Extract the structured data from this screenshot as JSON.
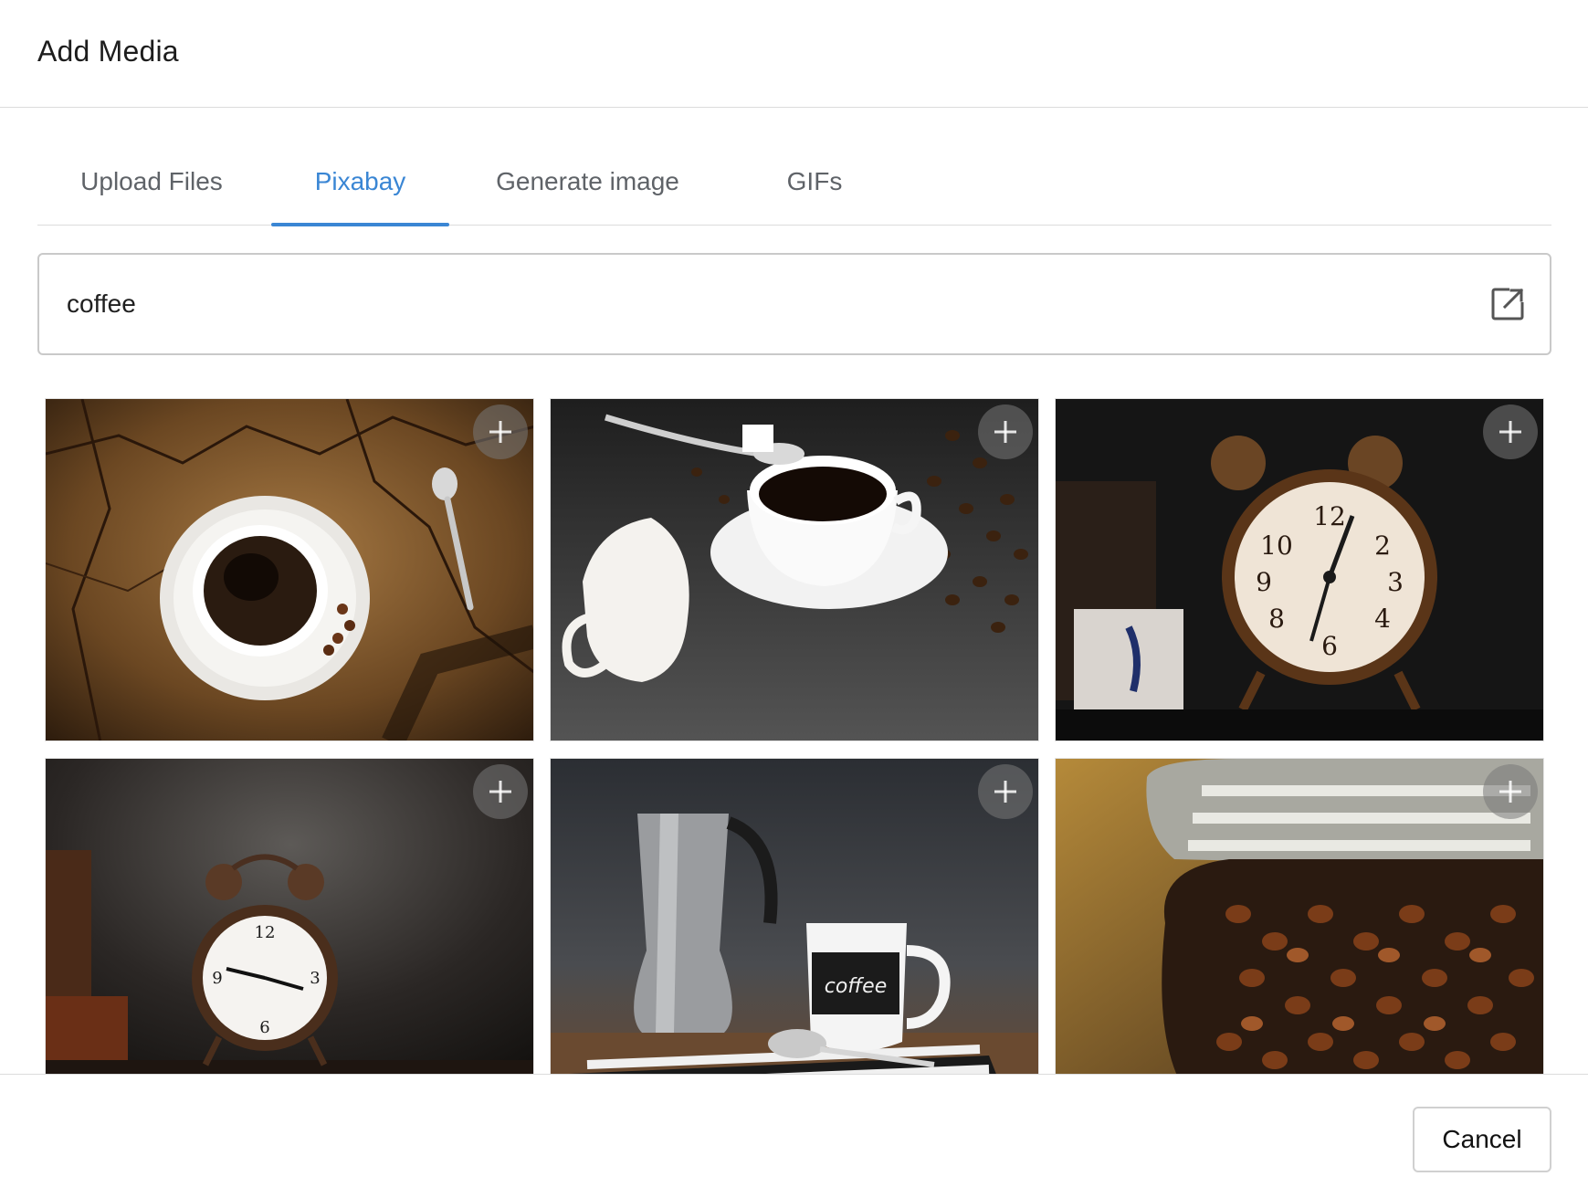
{
  "dialog": {
    "title": "Add Media"
  },
  "tabs": [
    {
      "label": "Upload Files",
      "active": false
    },
    {
      "label": "Pixabay",
      "active": true
    },
    {
      "label": "Generate image",
      "active": false
    },
    {
      "label": "GIFs",
      "active": false
    }
  ],
  "search": {
    "value": "coffee",
    "icon": "external-link-icon"
  },
  "results": [
    {
      "subject": "coffee cup on wooden stump",
      "action_icon": "plus-icon"
    },
    {
      "subject": "coffee cup with milk pitcher and beans",
      "action_icon": "plus-icon"
    },
    {
      "subject": "vintage alarm clock",
      "action_icon": "plus-icon"
    },
    {
      "subject": "alarm clock in dark room",
      "action_icon": "plus-icon"
    },
    {
      "subject": "moka pot and coffee mug",
      "action_icon": "plus-icon"
    },
    {
      "subject": "tin of coffee beans",
      "action_icon": "plus-icon"
    }
  ],
  "footer": {
    "cancel_label": "Cancel"
  },
  "colors": {
    "accent": "#3a86d4",
    "border": "#dcdcdc"
  }
}
